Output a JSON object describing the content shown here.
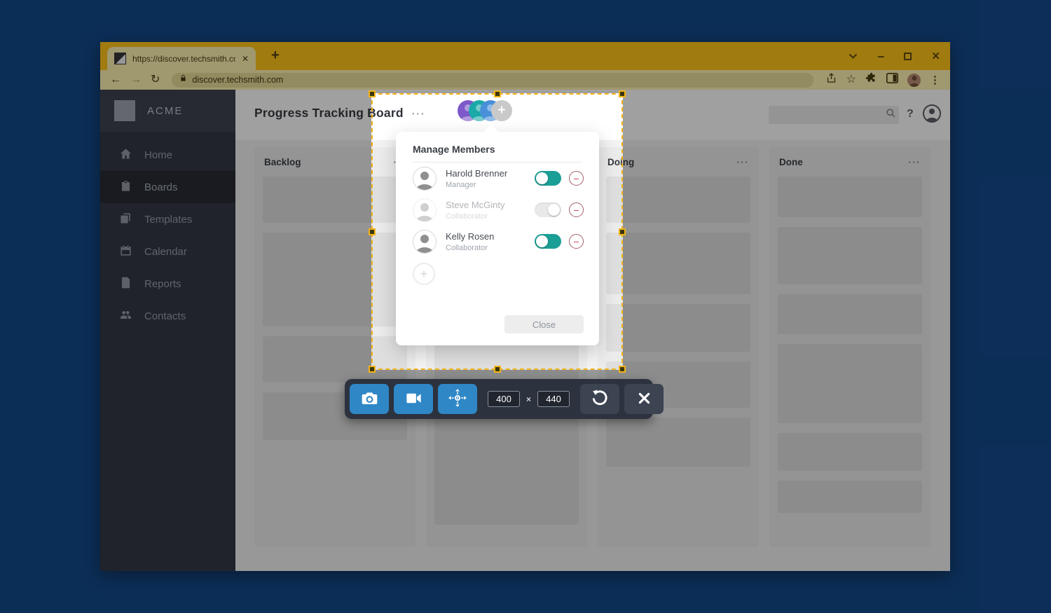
{
  "browser": {
    "tab_title": "https://discover.techsmith.com",
    "tab_close_glyph": "✕",
    "new_tab_glyph": "+",
    "url": "discover.techsmith.com",
    "back_glyph": "←",
    "forward_glyph": "→",
    "reload_glyph": "↻",
    "star_glyph": "☆",
    "more_glyph": "⋮",
    "window": {
      "minimize_glyph": "–",
      "close_glyph": "✕"
    }
  },
  "sidebar": {
    "brand": "ACME",
    "items": [
      {
        "label": "Home",
        "icon": "home-icon",
        "active": false
      },
      {
        "label": "Boards",
        "icon": "boards-icon",
        "active": true
      },
      {
        "label": "Templates",
        "icon": "templates-icon",
        "active": false
      },
      {
        "label": "Calendar",
        "icon": "calendar-icon",
        "active": false
      },
      {
        "label": "Reports",
        "icon": "reports-icon",
        "active": false
      },
      {
        "label": "Contacts",
        "icon": "contacts-icon",
        "active": false
      }
    ]
  },
  "app_header": {
    "title": "Progress Tracking Board",
    "menu_glyph": "···",
    "help_glyph": "?",
    "member_avatar_colors": [
      "#7d58c9",
      "#1ba8a8",
      "#4a90d9"
    ],
    "add_member_glyph": "+"
  },
  "board": {
    "columns": [
      {
        "label": "Backlog",
        "menu_glyph": "···",
        "cards": [
          66,
          134,
          66,
          68
        ]
      },
      {
        "label": "",
        "menu_glyph": "",
        "cards": [
          66,
          134,
          110,
          160
        ]
      },
      {
        "label": "Doing",
        "menu_glyph": "···",
        "cards": [
          66,
          88,
          68,
          66,
          70
        ]
      },
      {
        "label": "Done",
        "menu_glyph": "···",
        "cards": [
          58,
          82,
          57,
          113,
          54,
          46
        ]
      }
    ]
  },
  "popup": {
    "title": "Manage Members",
    "remove_glyph": "−",
    "add_glyph": "+",
    "close_label": "Close",
    "members": [
      {
        "name": "Harold Brenner",
        "role": "Manager",
        "enabled": true,
        "faded": false
      },
      {
        "name": "Steve McGinty",
        "role": "Collaborator",
        "enabled": false,
        "faded": true
      },
      {
        "name": "Kelly Rosen",
        "role": "Collaborator",
        "enabled": true,
        "faded": false
      }
    ]
  },
  "capture": {
    "width": "400",
    "height": "440",
    "separator": "×"
  },
  "colors": {
    "accent_gold": "#f2b418",
    "toggle_on": "#1b9e95",
    "capture_blue": "#2f87c6",
    "chrome_theme": "#ffc20e",
    "sidebar_bg": "#2b303c"
  }
}
